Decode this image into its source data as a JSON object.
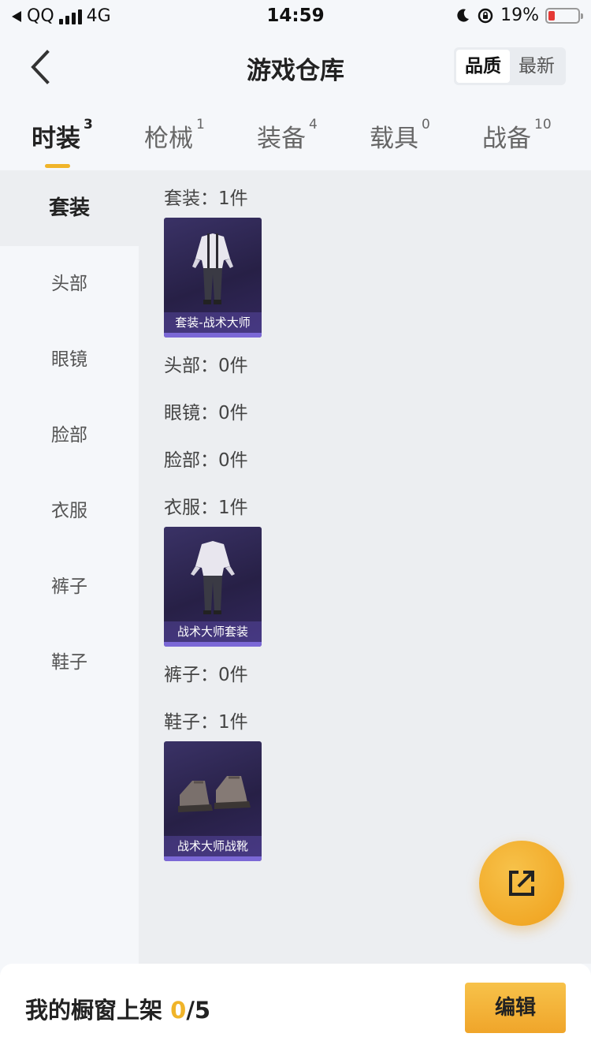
{
  "status_bar": {
    "carrier": "QQ",
    "network": "4G",
    "time": "14:59",
    "battery": "19%"
  },
  "header": {
    "title": "游戏仓库",
    "sort_options": [
      "品质",
      "最新"
    ],
    "sort_selected": "品质"
  },
  "tabs": [
    {
      "label": "时装",
      "count": "3",
      "active": true
    },
    {
      "label": "枪械",
      "count": "1",
      "active": false
    },
    {
      "label": "装备",
      "count": "4",
      "active": false
    },
    {
      "label": "载具",
      "count": "0",
      "active": false
    },
    {
      "label": "战备",
      "count": "10",
      "active": false
    }
  ],
  "subnav": [
    {
      "label": "套装",
      "active": true
    },
    {
      "label": "头部",
      "active": false
    },
    {
      "label": "眼镜",
      "active": false
    },
    {
      "label": "脸部",
      "active": false
    },
    {
      "label": "衣服",
      "active": false
    },
    {
      "label": "裤子",
      "active": false
    },
    {
      "label": "鞋子",
      "active": false
    }
  ],
  "sections": [
    {
      "title": "套装：1件",
      "items": [
        {
          "name": "套装-战术大师",
          "icon": "outfit-icon"
        }
      ]
    },
    {
      "title": "头部：0件",
      "items": []
    },
    {
      "title": "眼镜：0件",
      "items": []
    },
    {
      "title": "脸部：0件",
      "items": []
    },
    {
      "title": "衣服：1件",
      "items": [
        {
          "name": "战术大师套装",
          "icon": "clothes-icon"
        }
      ]
    },
    {
      "title": "裤子：0件",
      "items": []
    },
    {
      "title": "鞋子：1件",
      "items": [
        {
          "name": "战术大师战靴",
          "icon": "boots-icon"
        }
      ]
    }
  ],
  "bottom_bar": {
    "showcase_label": "我的橱窗上架",
    "showcase_current": "0",
    "showcase_total": "/5",
    "edit_label": "编辑"
  },
  "colors": {
    "accent": "#f0b429",
    "card_bg": "#2a2348",
    "card_strip": "#7b68d6"
  }
}
